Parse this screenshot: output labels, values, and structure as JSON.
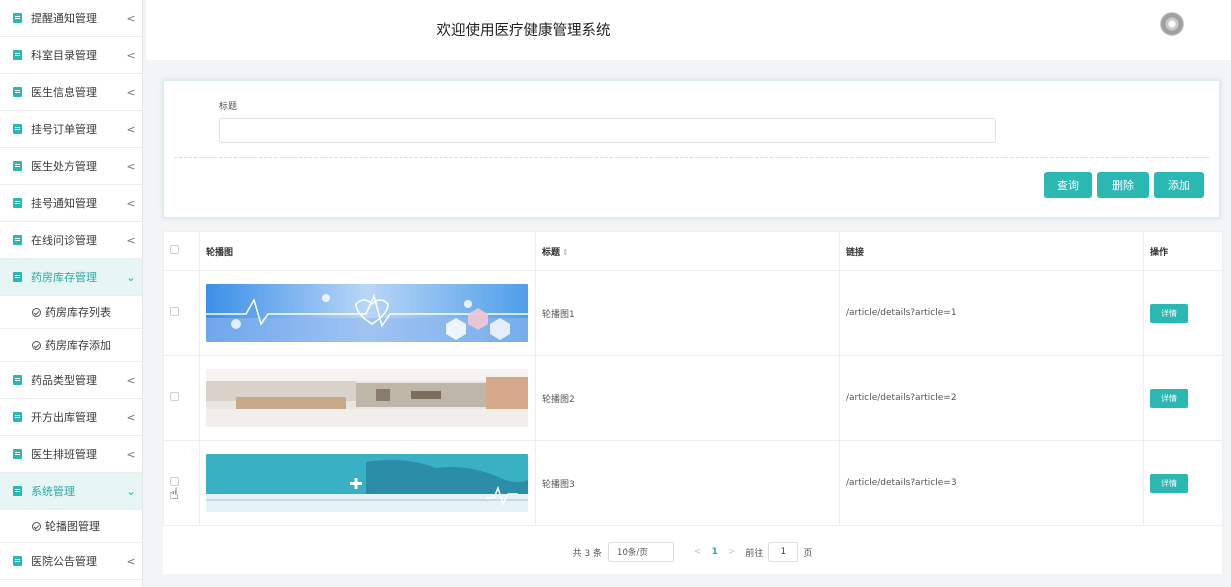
{
  "sidebar": {
    "items": [
      {
        "label": "提醒通知管理",
        "arrow": "<"
      },
      {
        "label": "科室目录管理",
        "arrow": "<"
      },
      {
        "label": "医生信息管理",
        "arrow": "<"
      },
      {
        "label": "挂号订单管理",
        "arrow": "<"
      },
      {
        "label": "医生处方管理",
        "arrow": "<"
      },
      {
        "label": "挂号通知管理",
        "arrow": "<"
      },
      {
        "label": "在线问诊管理",
        "arrow": "<"
      },
      {
        "label": "药房库存管理",
        "arrow": "⌄"
      },
      {
        "label": "药品类型管理",
        "arrow": "<"
      },
      {
        "label": "开方出库管理",
        "arrow": "<"
      },
      {
        "label": "医生排班管理",
        "arrow": "<"
      },
      {
        "label": "系统管理",
        "arrow": "⌄"
      },
      {
        "label": "医院公告管理",
        "arrow": "<"
      }
    ],
    "pharmacy_sub": [
      "药房库存列表",
      "药房库存添加"
    ],
    "system_sub": [
      "轮播图管理"
    ]
  },
  "header": {
    "title": "欢迎使用医疗健康管理系统"
  },
  "search": {
    "field_label": "标题",
    "field_value": "",
    "buttons": {
      "query": "查询",
      "delete": "删除",
      "add": "添加"
    }
  },
  "table": {
    "columns": {
      "image": "轮播图",
      "title": "标题",
      "title_sort": "⇕",
      "link": "链接",
      "action": "操作"
    },
    "rows": [
      {
        "title": "轮播图1",
        "link": "/article/details?article=1",
        "action": "详情"
      },
      {
        "title": "轮播图2",
        "link": "/article/details?article=2",
        "action": "详情"
      },
      {
        "title": "轮播图3",
        "link": "/article/details?article=3",
        "action": "详情"
      }
    ]
  },
  "pagination": {
    "total_text": "共 3 条",
    "page_size": "10条/页",
    "prev": "<",
    "current_page": "1",
    "next": ">",
    "goto_prefix": "前往",
    "goto_value": "1",
    "goto_suffix": "页"
  },
  "colors": {
    "accent": "#2bb8b3",
    "sidebar_active_bg": "#e7f5f4",
    "page_bg": "#f3f4f6"
  }
}
